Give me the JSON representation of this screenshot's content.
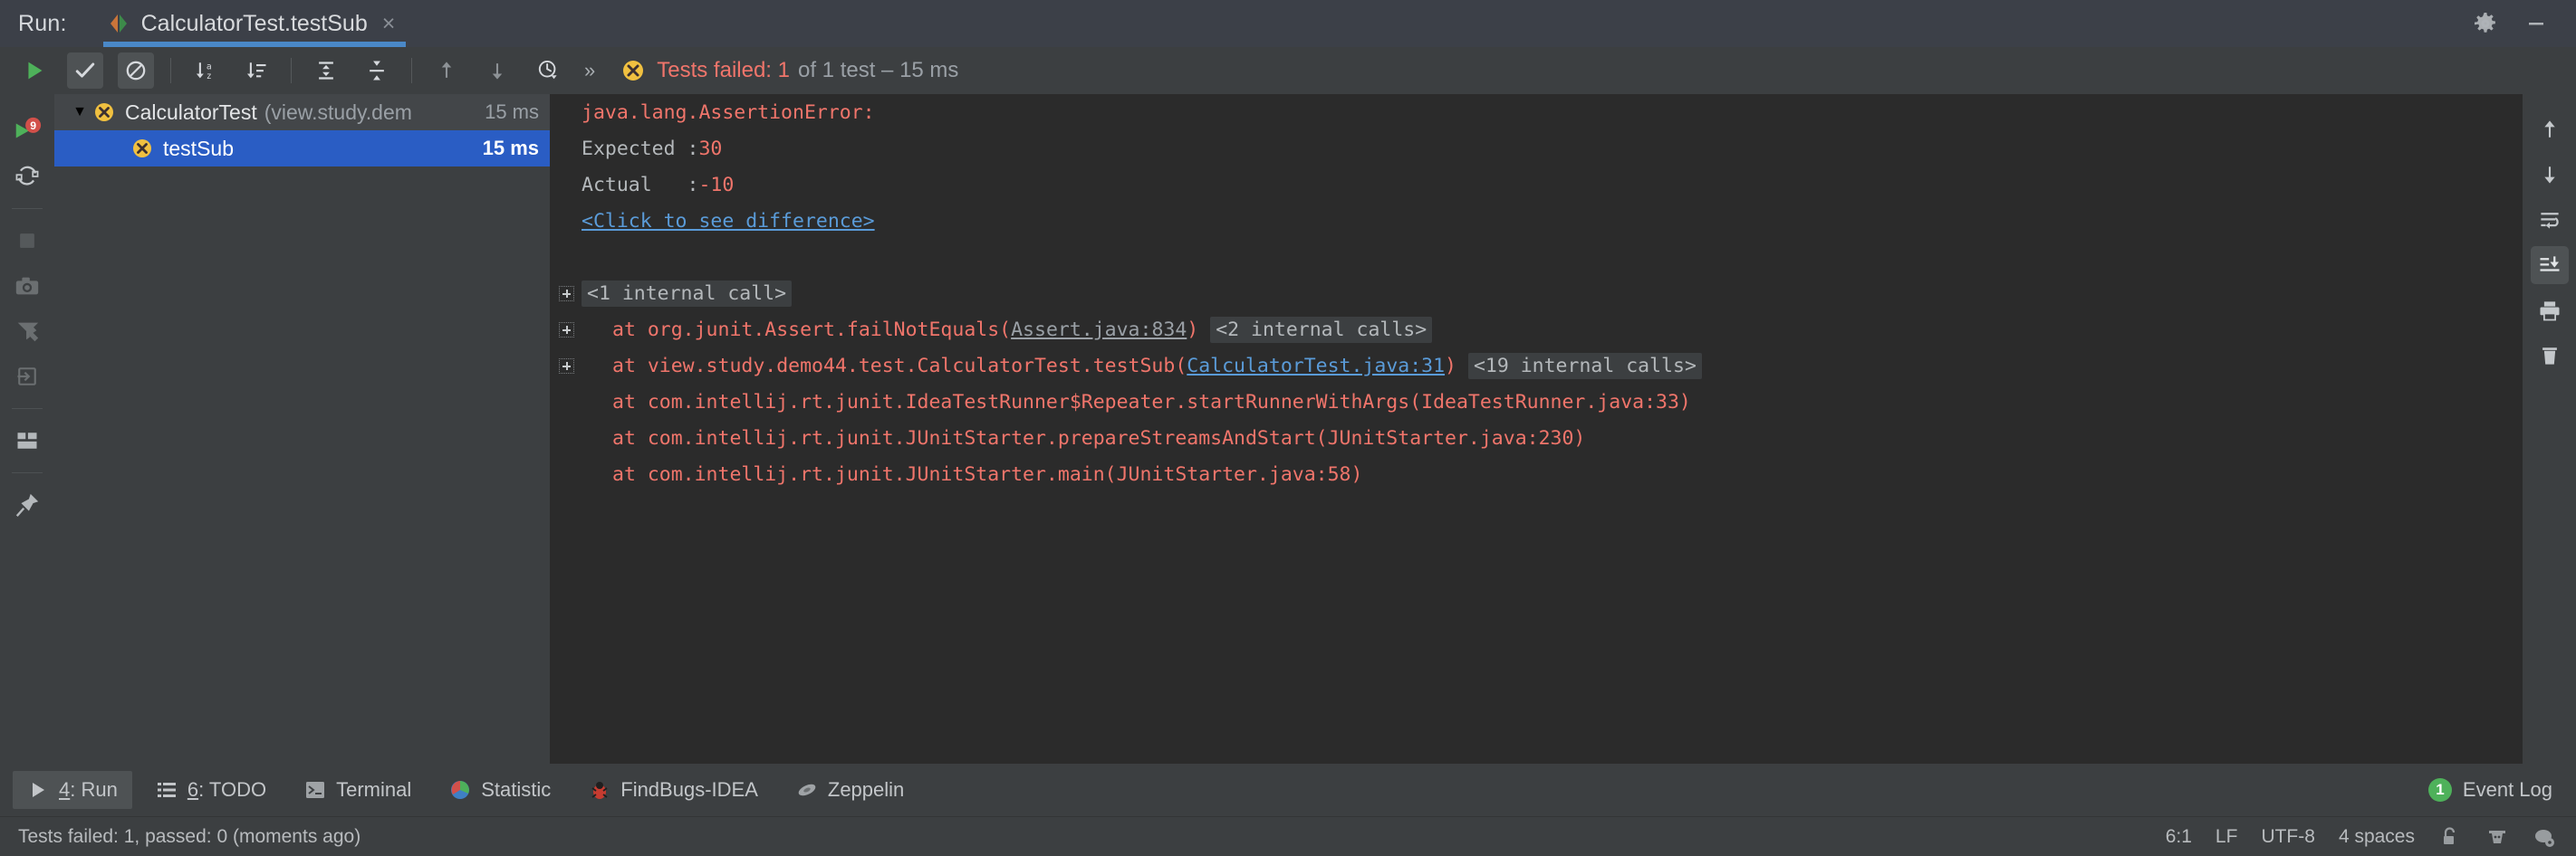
{
  "titlebar": {
    "run_label": "Run:",
    "tab_title": "CalculatorTest.testSub",
    "close_glyph": "×",
    "settings_icon": "gear-icon",
    "minimize_icon": "minimize-icon"
  },
  "toolbar": {
    "buttons": [
      {
        "name": "rerun-button",
        "icon": "play-icon"
      },
      {
        "name": "show-passed-toggle",
        "icon": "check-icon",
        "active": true
      },
      {
        "name": "show-ignored-toggle",
        "icon": "circle-slash-icon",
        "active": true
      },
      {
        "name": "sort-alphabetically-button",
        "icon": "sort-az-icon"
      },
      {
        "name": "sort-by-duration-button",
        "icon": "sort-duration-icon"
      },
      {
        "name": "expand-all-button",
        "icon": "expand-all-icon"
      },
      {
        "name": "collapse-all-button",
        "icon": "collapse-all-icon"
      },
      {
        "name": "previous-failed-button",
        "icon": "arrow-up-icon"
      },
      {
        "name": "next-failed-button",
        "icon": "arrow-down-icon"
      },
      {
        "name": "test-history-button",
        "icon": "clock-icon"
      }
    ],
    "more_glyph": "»",
    "status_icon": "test-failed-icon",
    "status_failed": "Tests failed: 1",
    "status_rest": "of 1 test – 15 ms"
  },
  "left_rail": {
    "items": [
      {
        "name": "rerun-tests-button",
        "icon": "rerun-icon"
      },
      {
        "name": "rerun-failed-tests-button",
        "icon": "rerun-failed-icon"
      },
      {
        "name": "stop-button",
        "icon": "stop-icon"
      },
      {
        "name": "screenshot-button",
        "icon": "camera-icon"
      },
      {
        "name": "filter-button",
        "icon": "filter-icon"
      },
      {
        "name": "import-tests-button",
        "icon": "import-icon"
      },
      {
        "name": "layout-button",
        "icon": "layout-icon"
      },
      {
        "name": "pin-tab-button",
        "icon": "pin-icon"
      }
    ]
  },
  "right_rail": {
    "items": [
      {
        "name": "scroll-up-button",
        "icon": "arrow-up-icon"
      },
      {
        "name": "scroll-down-button",
        "icon": "arrow-down-icon"
      },
      {
        "name": "soft-wrap-button",
        "icon": "soft-wrap-icon"
      },
      {
        "name": "scroll-to-end-button",
        "icon": "scroll-to-end-icon",
        "active": true
      },
      {
        "name": "print-button",
        "icon": "printer-icon"
      },
      {
        "name": "clear-all-button",
        "icon": "trash-icon"
      }
    ]
  },
  "tree": {
    "root": {
      "twist_glyph": "▼",
      "icon": "test-failed-icon",
      "label": "CalculatorTest",
      "package": "(view.study.dem",
      "time": "15 ms"
    },
    "child": {
      "icon": "test-failed-icon",
      "label": "testSub",
      "time": "15 ms"
    }
  },
  "console": {
    "lines": [
      {
        "fold": false,
        "indent": false,
        "segments": [
          {
            "text": "java.lang.AssertionError:",
            "style": "red"
          }
        ]
      },
      {
        "fold": false,
        "indent": false,
        "segments": [
          {
            "text": "Expected :",
            "style": "gray"
          },
          {
            "text": "30",
            "style": "red"
          }
        ]
      },
      {
        "fold": false,
        "indent": false,
        "segments": [
          {
            "text": "Actual   :",
            "style": "gray"
          },
          {
            "text": "-10",
            "style": "red"
          }
        ]
      },
      {
        "fold": false,
        "indent": false,
        "segments": [
          {
            "text": "<Click to see difference>",
            "style": "link"
          }
        ]
      },
      {
        "fold": false,
        "indent": false,
        "segments": []
      },
      {
        "fold": true,
        "indent": false,
        "segments": [
          {
            "text": "<1 internal call>",
            "style": "chip"
          }
        ]
      },
      {
        "fold": true,
        "indent": true,
        "segments": [
          {
            "text": "at org.junit.Assert.failNotEquals(",
            "style": "red"
          },
          {
            "text": "Assert.java:834",
            "style": "link-gray"
          },
          {
            "text": ")",
            "style": "red"
          },
          {
            "text": " ",
            "style": "gray"
          },
          {
            "text": "<2 internal calls>",
            "style": "chip"
          }
        ]
      },
      {
        "fold": true,
        "indent": true,
        "segments": [
          {
            "text": "at view.study.demo44.test.CalculatorTest.testSub(",
            "style": "red"
          },
          {
            "text": "CalculatorTest.java:31",
            "style": "link"
          },
          {
            "text": ")",
            "style": "red"
          },
          {
            "text": " ",
            "style": "gray"
          },
          {
            "text": "<19 internal calls>",
            "style": "chip"
          }
        ]
      },
      {
        "fold": false,
        "indent": true,
        "segments": [
          {
            "text": "at com.intellij.rt.junit.IdeaTestRunner$Repeater.startRunnerWithArgs(IdeaTestRunner.java:33)",
            "style": "red"
          }
        ]
      },
      {
        "fold": false,
        "indent": true,
        "segments": [
          {
            "text": "at com.intellij.rt.junit.JUnitStarter.prepareStreamsAndStart(JUnitStarter.java:230)",
            "style": "red"
          }
        ]
      },
      {
        "fold": false,
        "indent": true,
        "segments": [
          {
            "text": "at com.intellij.rt.junit.JUnitStarter.main(JUnitStarter.java:58)",
            "style": "red"
          }
        ]
      }
    ]
  },
  "bottom_tabs": [
    {
      "name": "tab-run",
      "icon": "play-icon",
      "key": "4",
      "label": ": Run",
      "active": true
    },
    {
      "name": "tab-todo",
      "icon": "list-icon",
      "key": "6",
      "label": ": TODO",
      "active": false
    },
    {
      "name": "tab-terminal",
      "icon": "terminal-icon",
      "key": "",
      "label": "Terminal",
      "active": false
    },
    {
      "name": "tab-statistic",
      "icon": "statistic-icon",
      "key": "",
      "label": "Statistic",
      "active": false
    },
    {
      "name": "tab-findbugs",
      "icon": "findbugs-icon",
      "key": "",
      "label": "FindBugs-IDEA",
      "active": false
    },
    {
      "name": "tab-zeppelin",
      "icon": "zeppelin-icon",
      "key": "",
      "label": "Zeppelin",
      "active": false
    }
  ],
  "event_log": {
    "count": "1",
    "label": "Event Log"
  },
  "statusbar": {
    "message": "Tests failed: 1, passed: 0 (moments ago)",
    "caret": "6:1",
    "line_separator": "LF",
    "encoding": "UTF-8",
    "indent": "4 spaces",
    "lock_icon": "unlocked-icon",
    "hector_icon": "hector-icon",
    "help_icon": "help-settings-icon"
  },
  "colors": {
    "accent_blue": "#4a88c7",
    "selection_blue": "#2a5dc4",
    "error_red": "#f0756b",
    "link_blue": "#5a9bd8",
    "console_bg": "#2b2b2b",
    "panel_bg": "#3c3f41",
    "badge_green": "#4eb15a",
    "fail_icon_yellow": "#f0c040"
  }
}
